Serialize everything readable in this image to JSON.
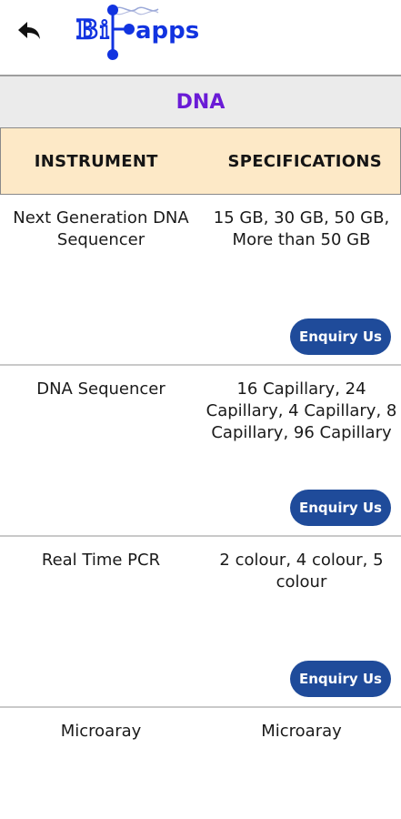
{
  "app": {
    "logo_text": "Bioapps"
  },
  "section": {
    "title": "DNA"
  },
  "table": {
    "headers": {
      "instrument": "INSTRUMENT",
      "specifications": "SPECIFICATIONS"
    },
    "rows": [
      {
        "instrument": "Next Generation DNA Sequencer",
        "specifications": "15 GB, 30 GB, 50 GB, More than 50 GB",
        "button": "Enquiry Us"
      },
      {
        "instrument": "DNA Sequencer",
        "specifications": "16 Capillary, 24 Capillary, 4 Capillary, 8 Capillary, 96 Capillary",
        "button": "Enquiry Us"
      },
      {
        "instrument": "Real Time PCR",
        "specifications": "2 colour, 4 colour, 5 colour",
        "button": "Enquiry Us"
      },
      {
        "instrument": "Microaray",
        "specifications": "Microaray"
      }
    ]
  },
  "colors": {
    "accent": "#6a1bd6",
    "button": "#1f4b9a",
    "header_bg": "#fde9c7",
    "logo_blue": "#1133e0"
  },
  "icons": {
    "back": "arrow-left-icon"
  }
}
